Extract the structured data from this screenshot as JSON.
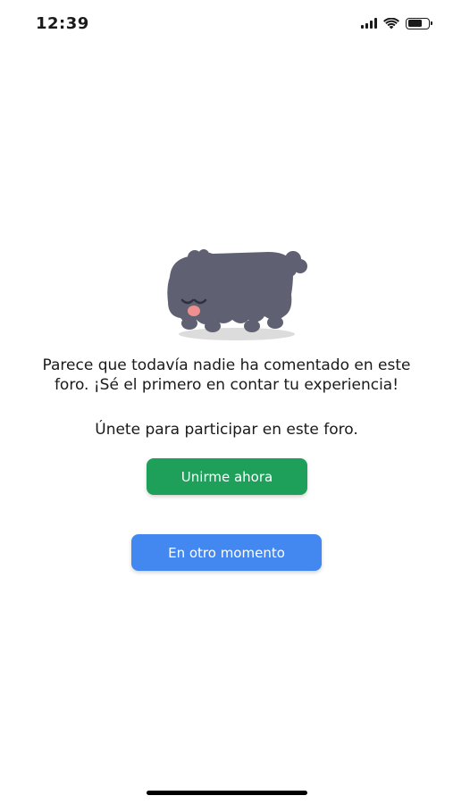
{
  "status_bar": {
    "time": "12:39",
    "icons": [
      "cellular-signal-icon",
      "wifi-icon",
      "battery-icon"
    ]
  },
  "illustration": {
    "icon": "sheepdog-mascot-icon",
    "body_color": "#5f6173"
  },
  "empty_state": {
    "message": "Parece que todavía nadie ha comentado en este foro. ¡Sé el primero en contar tu experiencia!",
    "cta_text": "Únete para participar en este foro."
  },
  "buttons": {
    "join_label": "Unirme ahora",
    "later_label": "En otro momento"
  },
  "colors": {
    "join_button": "#1ea05a",
    "later_button": "#4388f0"
  }
}
